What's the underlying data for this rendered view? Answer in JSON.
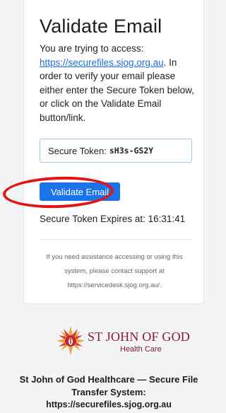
{
  "card": {
    "title": "Validate Email",
    "intro_prefix": "You are trying to access:",
    "intro_link": "https://securefiles.sjog.org.au",
    "intro_suffix": ". In order to verify your email please either enter the Secure Token below, or click on the Validate Email button/link.",
    "token_label": "Secure Token:",
    "token_value": "sH3s-GS2Y",
    "validate_button": "Validate Email",
    "expires_text": "Secure Token Expires at: 16:31:41",
    "assist_text": "If you need assistance accessing or using this system, please contact support at https://servicedesk.sjog.org.au/."
  },
  "logo": {
    "name": "ST JOHN OF GOD",
    "sub": "Health Care"
  },
  "footer": {
    "title": "St John of God Healthcare — Secure File Transfer System:",
    "link": "https://securefiles.sjog.org.au"
  },
  "colors": {
    "accent": "#1a73e8",
    "link": "#1a6fe0",
    "highlight": "#e31414",
    "brand": "#8b1a2b"
  }
}
